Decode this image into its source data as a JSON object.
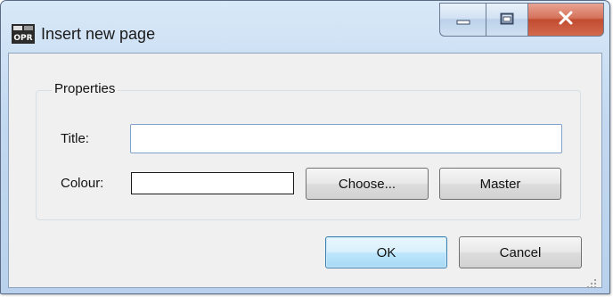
{
  "window": {
    "title": "Insert new page",
    "app_icon": "app-icon",
    "caption_buttons": [
      {
        "name": "minimize",
        "icon": "minimize-icon"
      },
      {
        "name": "maximize",
        "icon": "maximize-icon"
      },
      {
        "name": "close",
        "icon": "close-icon"
      }
    ]
  },
  "properties": {
    "group_label": "Properties",
    "title_label": "Title:",
    "title_value": "",
    "colour_label": "Colour:",
    "colour_value": "#ffffff",
    "choose_label": "Choose...",
    "master_label": "Master"
  },
  "footer": {
    "ok_label": "OK",
    "cancel_label": "Cancel"
  },
  "colors": {
    "close_button": "#c24c30",
    "default_button_border": "#3c7fb1",
    "dialog_bg": "#f0f0f0",
    "titlebar": "#c3d9f0"
  }
}
